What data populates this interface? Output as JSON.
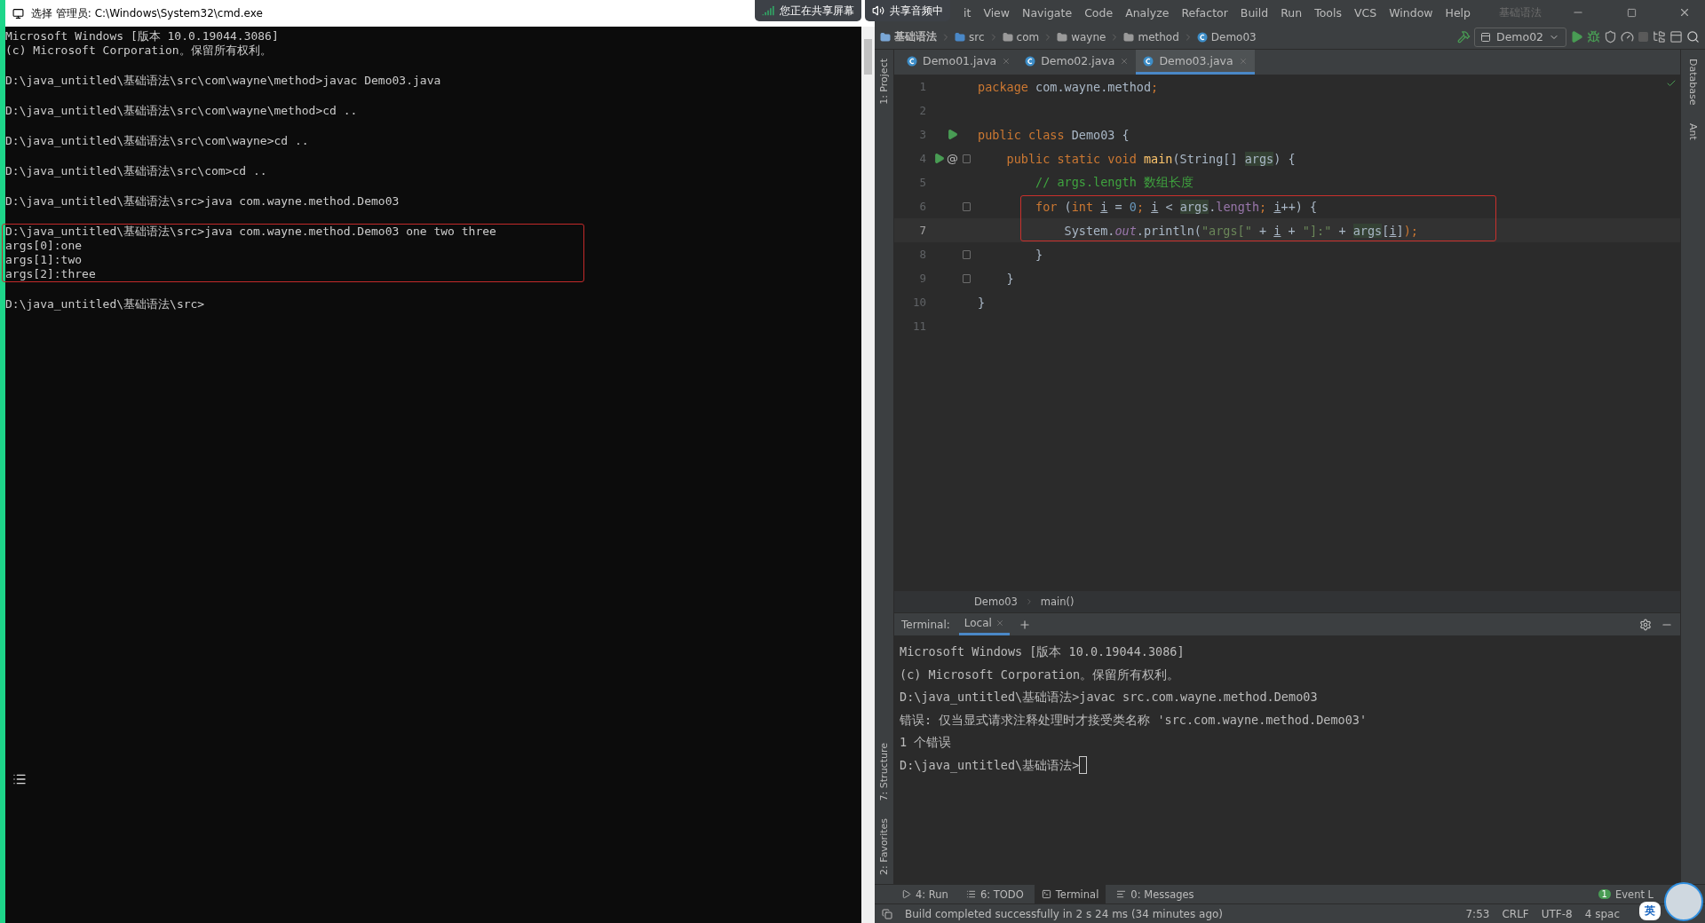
{
  "cmd": {
    "title": "选择 管理员: C:\\Windows\\System32\\cmd.exe",
    "blocks": [
      {
        "boxed": false,
        "lines": [
          "Microsoft Windows [版本 10.0.19044.3086]",
          "(c) Microsoft Corporation。保留所有权利。"
        ]
      },
      {
        "boxed": false,
        "lines": [
          "D:\\java_untitled\\基础语法\\src\\com\\wayne\\method>javac Demo03.java"
        ]
      },
      {
        "boxed": false,
        "lines": [
          "D:\\java_untitled\\基础语法\\src\\com\\wayne\\method>cd .."
        ]
      },
      {
        "boxed": false,
        "lines": [
          "D:\\java_untitled\\基础语法\\src\\com\\wayne>cd .."
        ]
      },
      {
        "boxed": false,
        "lines": [
          "D:\\java_untitled\\基础语法\\src\\com>cd .."
        ]
      },
      {
        "boxed": false,
        "lines": [
          "D:\\java_untitled\\基础语法\\src>java com.wayne.method.Demo03"
        ]
      },
      {
        "boxed": true,
        "lines": [
          "D:\\java_untitled\\基础语法\\src>java com.wayne.method.Demo03 one two three",
          "args[0]:one",
          "args[1]:two",
          "args[2]:three"
        ]
      },
      {
        "boxed": false,
        "lines": [
          "D:\\java_untitled\\基础语法\\src>"
        ]
      }
    ]
  },
  "share": {
    "screen": "您正在共享屏幕",
    "audio": "共享音频中"
  },
  "ide": {
    "menu": [
      "it",
      "View",
      "Navigate",
      "Code",
      "Analyze",
      "Refactor",
      "Build",
      "Run",
      "Tools",
      "VCS",
      "Window",
      "Help"
    ],
    "title": "基础语法",
    "breadcrumbs": [
      {
        "label": "基础语法",
        "kind": "module"
      },
      {
        "label": "src",
        "kind": "folder"
      },
      {
        "label": "com",
        "kind": "package"
      },
      {
        "label": "wayne",
        "kind": "package"
      },
      {
        "label": "method",
        "kind": "package"
      },
      {
        "label": "Demo03",
        "kind": "class"
      }
    ],
    "run_config": "Demo02",
    "tabs": [
      {
        "label": "Demo01.java",
        "selected": false
      },
      {
        "label": "Demo02.java",
        "selected": false
      },
      {
        "label": "Demo03.java",
        "selected": true
      }
    ],
    "left_tools": [
      {
        "label": "1: Project",
        "kind": "top"
      },
      {
        "label": "7: Structure",
        "kind": "bottom"
      },
      {
        "label": "2: Favorites",
        "kind": "bottom"
      }
    ],
    "right_tools": [
      "Database",
      "Ant"
    ],
    "line_groups": [
      {
        "boxed": false,
        "lines": [
          {
            "number": "1",
            "current": false,
            "tokens": [
              {
                "text": "package ",
                "kind": "kw"
              },
              {
                "text": "com.wayne.method",
                "kind": "plain"
              },
              {
                "text": ";",
                "kind": "kw"
              }
            ]
          },
          {
            "number": "2",
            "current": false
          },
          {
            "number": "3",
            "current": false,
            "markers": [
              {
                "kind": "run"
              }
            ],
            "tokens": [
              {
                "text": "public class ",
                "kind": "kw"
              },
              {
                "text": "Demo03 {",
                "kind": "plain"
              }
            ]
          },
          {
            "number": "4",
            "current": false,
            "markers": [
              {
                "kind": "run"
              },
              {
                "kind": "text",
                "text": "@"
              },
              {
                "kind": "fold"
              }
            ],
            "tokens": [
              {
                "text": "    public static void ",
                "kind": "kw"
              },
              {
                "text": "main",
                "kind": "method"
              },
              {
                "text": "(String[] ",
                "kind": "plain"
              },
              {
                "text": "args",
                "kind": "usage"
              },
              {
                "text": ") {",
                "kind": "plain"
              }
            ]
          },
          {
            "number": "5",
            "current": false,
            "tokens": [
              {
                "text": "        // args.length 数组长度",
                "kind": "comment"
              }
            ]
          }
        ]
      },
      {
        "boxed": true,
        "lines": [
          {
            "number": "6",
            "current": false,
            "markers": [
              {
                "kind": "fold"
              }
            ],
            "tokens": [
              {
                "text": "        for ",
                "kind": "kw"
              },
              {
                "text": "(",
                "kind": "plain"
              },
              {
                "text": "int ",
                "kind": "kw"
              },
              {
                "text": "i",
                "kind": "var"
              },
              {
                "text": " = ",
                "kind": "plain"
              },
              {
                "text": "0",
                "kind": "num"
              },
              {
                "text": "; ",
                "kind": "kw"
              },
              {
                "text": "i",
                "kind": "var"
              },
              {
                "text": " < ",
                "kind": "plain"
              },
              {
                "text": "args",
                "kind": "usage"
              },
              {
                "text": ".",
                "kind": "plain"
              },
              {
                "text": "length",
                "kind": "member"
              },
              {
                "text": "; ",
                "kind": "kw"
              },
              {
                "text": "i",
                "kind": "var"
              },
              {
                "text": "++) {",
                "kind": "plain"
              }
            ]
          },
          {
            "number": "7",
            "current": true,
            "tokens": [
              {
                "text": "            System.",
                "kind": "plain"
              },
              {
                "text": "out",
                "kind": "static"
              },
              {
                "text": ".println(",
                "kind": "plain"
              },
              {
                "text": "\"args[\"",
                "kind": "string"
              },
              {
                "text": " + ",
                "kind": "plain"
              },
              {
                "text": "i",
                "kind": "var"
              },
              {
                "text": " + ",
                "kind": "plain"
              },
              {
                "text": "\"]:\"",
                "kind": "string"
              },
              {
                "text": " + ",
                "kind": "plain"
              },
              {
                "text": "args",
                "kind": "usage"
              },
              {
                "text": "[",
                "kind": "plain"
              },
              {
                "text": "i",
                "kind": "var"
              },
              {
                "text": "]",
                "kind": "plain"
              },
              {
                "text": ");",
                "kind": "kw"
              }
            ]
          }
        ]
      },
      {
        "boxed": false,
        "lines": [
          {
            "number": "8",
            "current": false,
            "markers": [
              {
                "kind": "fold"
              }
            ],
            "tokens": [
              {
                "text": "        }",
                "kind": "plain"
              }
            ]
          },
          {
            "number": "9",
            "current": false,
            "markers": [
              {
                "kind": "fold"
              }
            ],
            "tokens": [
              {
                "text": "    }",
                "kind": "plain"
              }
            ]
          },
          {
            "number": "10",
            "current": false,
            "tokens": [
              {
                "text": "}",
                "kind": "plain"
              }
            ]
          },
          {
            "number": "11",
            "current": false
          }
        ]
      }
    ],
    "editor_crumbs": [
      "Demo03",
      "main()"
    ],
    "terminal": {
      "label": "Terminal:",
      "tab": "Local",
      "cursor": true,
      "lines": [
        "Microsoft Windows [版本 10.0.19044.3086]",
        "(c) Microsoft Corporation。保留所有权利。",
        "D:\\java_untitled\\基础语法>javac src.com.wayne.method.Demo03",
        "错误: 仅当显式请求注释处理时才接受类名称 'src.com.wayne.method.Demo03'",
        "1 个错误",
        "D:\\java_untitled\\基础语法>"
      ]
    },
    "tool_tabs": [
      {
        "label": "4: Run",
        "kind": "run",
        "selected": false
      },
      {
        "label": "6: TODO",
        "kind": "todo",
        "selected": false
      },
      {
        "label": "Terminal",
        "kind": "terminal",
        "selected": true
      },
      {
        "label": "0: Messages",
        "kind": "messages",
        "selected": false
      }
    ],
    "event_log": {
      "count": "1",
      "label": "Event L"
    },
    "status": {
      "message": "Build completed successfully in 2 s 24 ms (34 minutes ago)",
      "items": [
        "7:53",
        "CRLF",
        "UTF-8",
        "4 spac"
      ]
    },
    "ime": "英"
  }
}
